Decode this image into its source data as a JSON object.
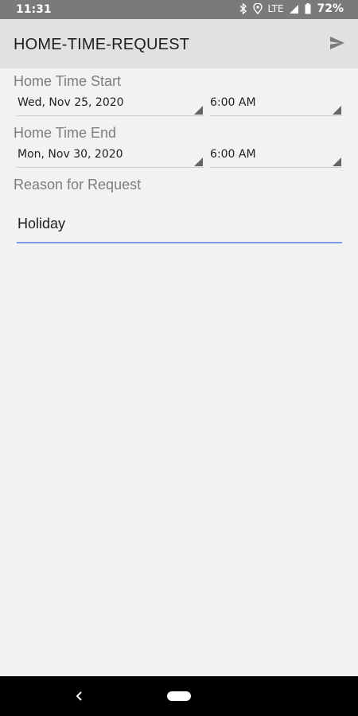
{
  "status_bar": {
    "time": "11:31",
    "network": "LTE",
    "battery": "72%",
    "icons": [
      "bluetooth-icon",
      "location-icon",
      "signal-icon",
      "battery-icon"
    ]
  },
  "app_bar": {
    "title": "HOME-TIME-REQUEST",
    "action_icon": "send-icon"
  },
  "form": {
    "start": {
      "label": "Home Time Start",
      "date": "Wed, Nov 25, 2020",
      "time": "6:00 AM"
    },
    "end": {
      "label": "Home Time End",
      "date": "Mon, Nov 30, 2020",
      "time": "6:00 AM"
    },
    "reason": {
      "label": "Reason for Request",
      "value": "Holiday"
    }
  },
  "colors": {
    "accent": "#7a9ae6",
    "app_bar": "#e2e2e2",
    "background": "#f1f2f4",
    "status_bar": "#7a7a7a"
  },
  "nav_bar": {
    "icons": [
      "back-icon",
      "home-pill-icon"
    ]
  }
}
